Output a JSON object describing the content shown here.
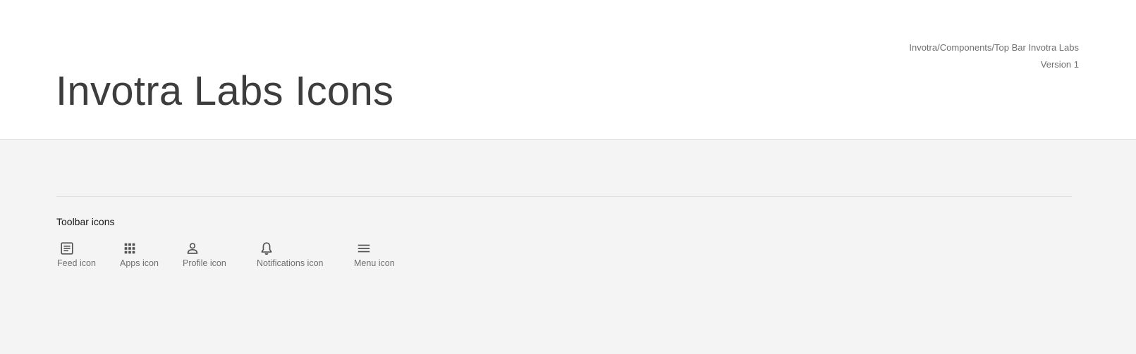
{
  "header": {
    "title": "Invotra Labs Icons",
    "breadcrumb": "Invotra/Components/Top Bar Invotra Labs",
    "version": "Version 1"
  },
  "section": {
    "title": "Toolbar icons",
    "icons": [
      {
        "name": "feed-icon",
        "label": "Feed icon"
      },
      {
        "name": "apps-icon",
        "label": "Apps icon"
      },
      {
        "name": "profile-icon",
        "label": "Profile icon"
      },
      {
        "name": "notifications-icon",
        "label": "Notifications icon"
      },
      {
        "name": "menu-icon",
        "label": "Menu icon"
      }
    ]
  },
  "colors": {
    "header_bg": "#ffffff",
    "content_bg": "#f4f4f4",
    "title_text": "#3d3d3d",
    "muted_text": "#6f6f6f",
    "icon_color": "#525252"
  }
}
